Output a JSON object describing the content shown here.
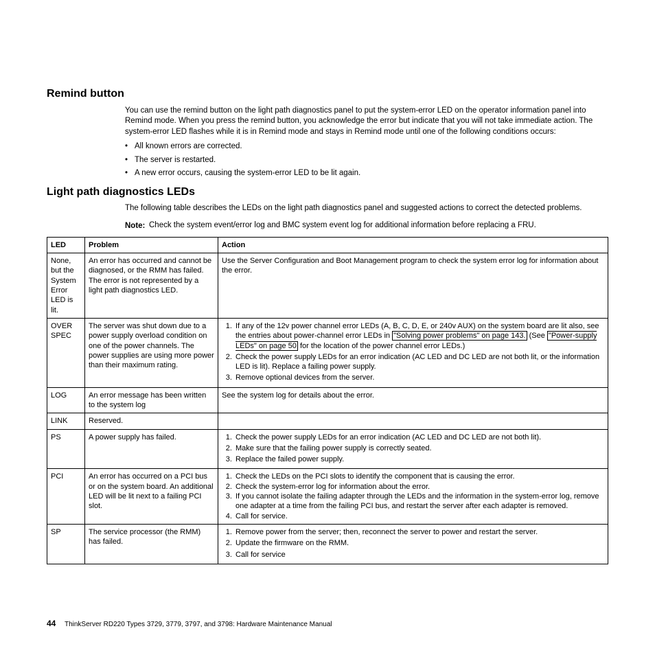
{
  "section1": {
    "title": "Remind button",
    "para": "You can use the remind button on the light path diagnostics panel to put the system-error LED on the operator information panel into Remind mode. When you press the remind button, you acknowledge the error but indicate that you will not take immediate action. The system-error LED flashes while it is in Remind mode and stays in Remind mode until one of the following conditions occurs:",
    "bullets": [
      "All known errors are corrected.",
      "The server is restarted.",
      "A new error occurs, causing the system-error LED to be lit again."
    ]
  },
  "section2": {
    "title": "Light path diagnostics LEDs",
    "para": "The following table describes the LEDs on the light path diagnostics panel and suggested actions to correct the detected problems.",
    "note_label": "Note:",
    "note_text": "Check the system event/error log and BMC system event log for additional information before replacing a FRU."
  },
  "table": {
    "headers": {
      "led": "LED",
      "problem": "Problem",
      "action": "Action"
    },
    "rows": {
      "r0": {
        "led": "None, but the System Error LED is lit.",
        "problem": "An error has occurred and cannot be diagnosed, or the RMM has failed. The error is not represented by a light path diagnostics LED.",
        "action": "Use the Server Configuration and Boot Management program to check the system error log for information about the error."
      },
      "r1": {
        "led": "OVER SPEC",
        "problem": "The server was shut down due to a power supply overload condition on one of the power channels. The power supplies are using more power than their maximum rating.",
        "a1_pre": "If any of the 12v power channel error LEDs (A, B, C, D, E, or 240v AUX) on the system board are lit also, see the entries about power-channel error LEDs in ",
        "a1_link1": "\"Solving power problems\" on page 143.",
        "a1_mid": " (See ",
        "a1_link2": "\"Power-supply LEDs\" on page 50",
        "a1_post": " for the location of the power channel error LEDs.)",
        "a2": "Check the power supply LEDs for an error indication (AC LED and DC LED are not both lit, or the information LED is lit). Replace a failing power supply.",
        "a3": "Remove optional devices from the server."
      },
      "r2": {
        "led": "LOG",
        "problem": "An error message has been written to the system log",
        "action": "See the system log for details about the error."
      },
      "r3": {
        "led": "LINK",
        "problem": "Reserved.",
        "action": ""
      },
      "r4": {
        "led": "PS",
        "problem": "A power supply has failed.",
        "a1": "Check the power supply LEDs for an error indication (AC LED and DC LED are not both lit).",
        "a2": "Make sure that the failing power supply is correctly seated.",
        "a3": "Replace the failed power supply."
      },
      "r5": {
        "led": "PCI",
        "problem": "An error has occurred on a PCI bus or on the system board. An additional LED will be lit next to a failing PCI slot.",
        "a1": "Check the LEDs on the PCI slots to identify the component that is causing the error.",
        "a2": "Check the system-error log for information about the error.",
        "a3": "If you cannot isolate the failing adapter through the LEDs and the information in the system-error log, remove one adapter at a time from the failing PCI bus, and restart the server after each adapter is removed.",
        "a4": "Call for service."
      },
      "r6": {
        "led": "SP",
        "problem": "The service processor (the RMM) has failed.",
        "a1": "Remove power from the server; then, reconnect the server to power and restart the server.",
        "a2": "Update the firmware on the RMM.",
        "a3": "Call for service"
      }
    }
  },
  "footer": {
    "page": "44",
    "text": "ThinkServer RD220 Types 3729, 3779, 3797, and 3798: Hardware Maintenance Manual"
  }
}
